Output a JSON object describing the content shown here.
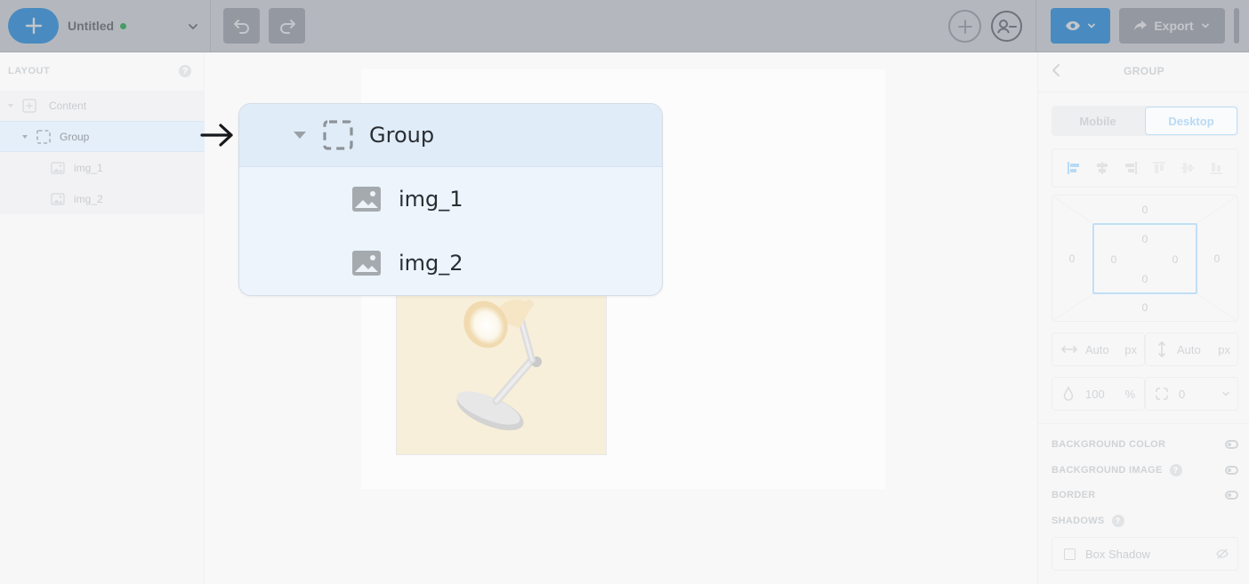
{
  "topbar": {
    "project_name": "Untitled",
    "export_label": "Export",
    "accent_color": "#4aa9f0",
    "status_dot_color": "#44c36a"
  },
  "layout_panel": {
    "title": "LAYOUT",
    "help": "?",
    "items": [
      {
        "label": "Content",
        "icon": "content-icon"
      },
      {
        "label": "Group",
        "icon": "group-dashed-icon",
        "selected": true
      },
      {
        "label": "img_1",
        "icon": "image-icon"
      },
      {
        "label": "img_2",
        "icon": "image-icon"
      }
    ]
  },
  "callout": {
    "group_label": "Group",
    "children": [
      "img_1",
      "img_2"
    ]
  },
  "properties": {
    "title": "GROUP",
    "tabs": {
      "mobile": "Mobile",
      "desktop": "Desktop",
      "active": "desktop"
    },
    "box_model": {
      "margin_top": "0",
      "margin_right": "0",
      "margin_bottom": "0",
      "margin_left": "0",
      "padding_top": "0",
      "padding_right": "0",
      "padding_bottom": "0",
      "padding_left": "0"
    },
    "width": {
      "value": "Auto",
      "unit": "px"
    },
    "height": {
      "value": "Auto",
      "unit": "px"
    },
    "opacity": {
      "value": "100",
      "unit": "%"
    },
    "radius": {
      "value": "0"
    },
    "sections": {
      "background_color": "BACKGROUND COLOR",
      "background_image": "BACKGROUND IMAGE",
      "border": "BORDER",
      "shadows": "SHADOWS"
    },
    "help": "?",
    "box_shadow_label": "Box Shadow"
  }
}
